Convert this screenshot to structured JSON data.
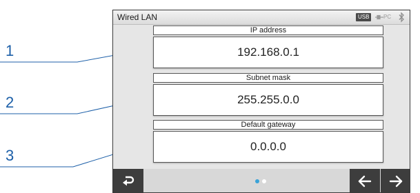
{
  "callouts": [
    "1",
    "2",
    "3"
  ],
  "window": {
    "title": "Wired LAN",
    "status": {
      "usb_label": "USB",
      "pc_label": "PC",
      "usb_icon": "usb-status-icon",
      "pc_icon": "pc-connection-icon",
      "bt_icon": "bluetooth-icon"
    }
  },
  "fields": [
    {
      "label": "IP address",
      "value": "192.168.0.1"
    },
    {
      "label": "Subnet mask",
      "value": "255.255.0.0"
    },
    {
      "label": "Default gateway",
      "value": "0.0.0.0"
    }
  ],
  "bottom_bar": {
    "back_icon": "return-icon",
    "prev_icon": "arrow-left-icon",
    "next_icon": "arrow-right-icon",
    "page_indicator": {
      "pages": 2,
      "current": 1
    },
    "colors": {
      "active_dot": "#3aa3d8",
      "inactive_dot": "#ffffff",
      "button_bg": "#3d3d3d"
    }
  },
  "colors": {
    "callout": "#1c5fa8"
  }
}
